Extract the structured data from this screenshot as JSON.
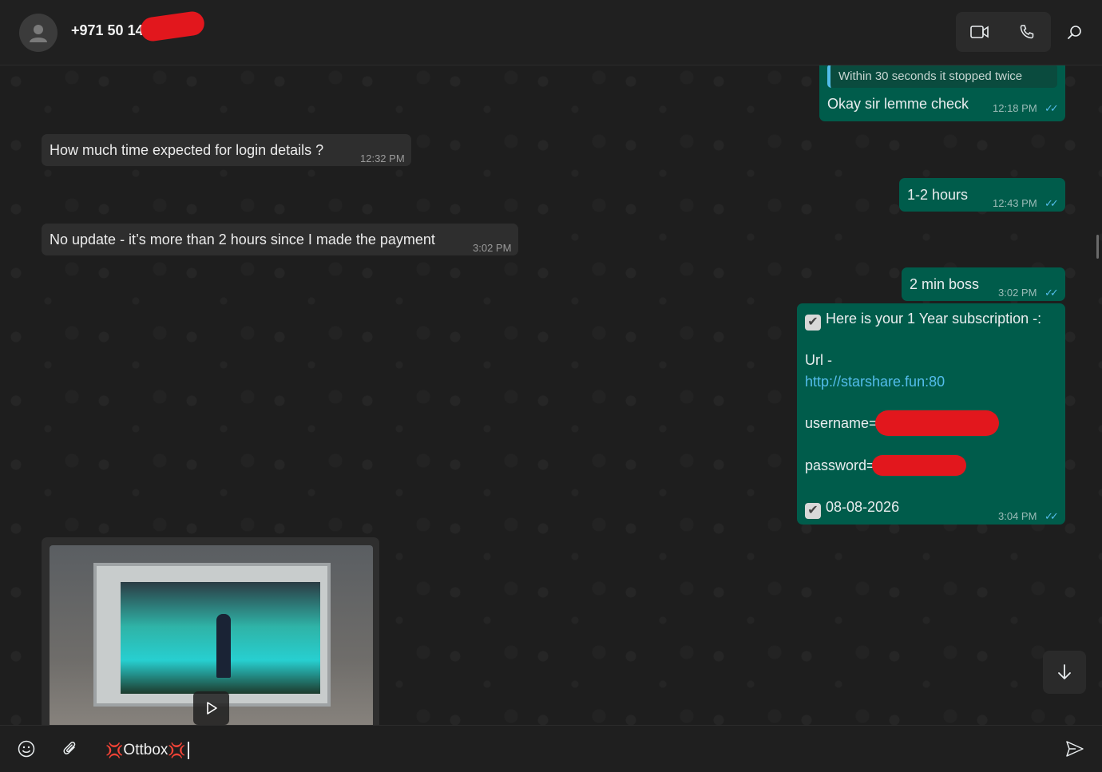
{
  "header": {
    "contact_name": "+971 50 14",
    "icons": [
      "avatar-icon",
      "video-call-icon",
      "voice-call-icon",
      "search-icon"
    ]
  },
  "messages": {
    "quote_text": "Within 30 seconds it stopped twice",
    "m1_text": "Okay sir lemme check",
    "m1_time": "12:18 PM",
    "m2_text": "How much time expected for login details ?",
    "m2_time": "12:32 PM",
    "m3_text": "1-2 hours",
    "m3_time": "12:43 PM",
    "m4_text": "No update - it’s more than 2 hours since I made the payment",
    "m4_time": "3:02 PM",
    "m5_text": "2 min boss",
    "m5_time": "3:02 PM",
    "m6_line1": "Here is your 1 Year subscription -:",
    "m6_url_label": "Url -",
    "m6_url": "http://starshare.fun:80",
    "m6_username": "username=",
    "m6_password": "password=",
    "m6_date": "08-08-2026",
    "m6_time": "3:04 PM",
    "ticks": "✓✓"
  },
  "composer": {
    "emoji_left": "💢",
    "text": "Ottbox",
    "emoji_right": "💢"
  },
  "colors": {
    "outgoing_bubble": "#005c4b",
    "incoming_bubble": "#2e2e2e",
    "read_ticks": "#53bdeb",
    "redaction": "#e2171d"
  }
}
